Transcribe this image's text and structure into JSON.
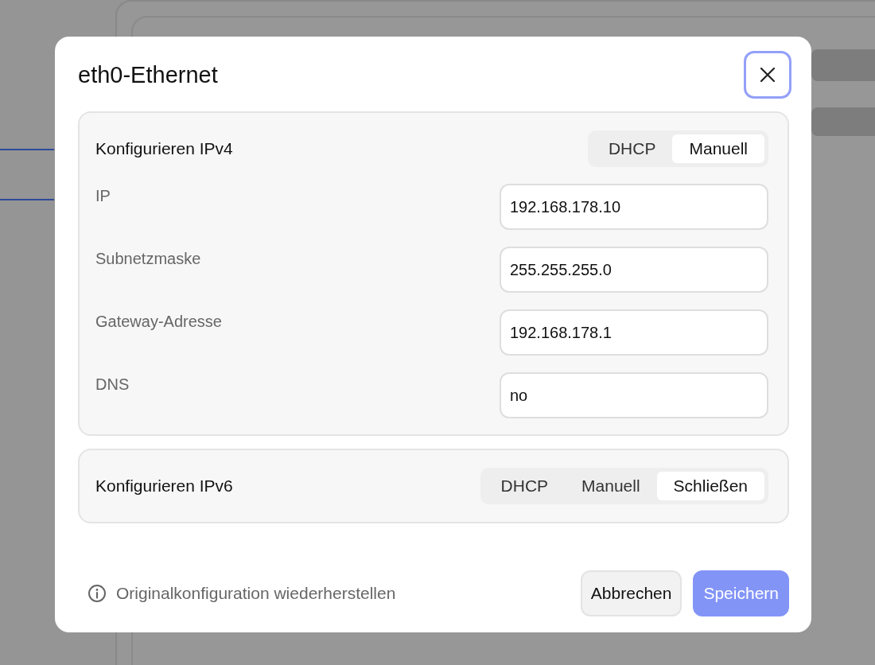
{
  "dialog": {
    "title": "eth0-Ethernet"
  },
  "ipv4": {
    "label": "Konfigurieren IPv4",
    "modes": [
      {
        "label": "DHCP",
        "selected": false
      },
      {
        "label": "Manuell",
        "selected": true
      }
    ],
    "fields": [
      {
        "label": "IP",
        "value": "192.168.178.10"
      },
      {
        "label": "Subnetzmaske",
        "value": "255.255.255.0"
      },
      {
        "label": "Gateway-Adresse",
        "value": "192.168.178.1"
      },
      {
        "label": "DNS",
        "value": "no"
      }
    ]
  },
  "ipv6": {
    "label": "Konfigurieren IPv6",
    "modes": [
      {
        "label": "DHCP",
        "selected": false
      },
      {
        "label": "Manuell",
        "selected": false
      },
      {
        "label": "Schließen",
        "selected": true
      }
    ]
  },
  "footer": {
    "restore_link": "Originalkonfiguration wiederherstellen",
    "buttons": [
      {
        "label": "Abbrechen",
        "kind": "secondary"
      },
      {
        "label": "Speichern",
        "kind": "primary"
      }
    ]
  }
}
